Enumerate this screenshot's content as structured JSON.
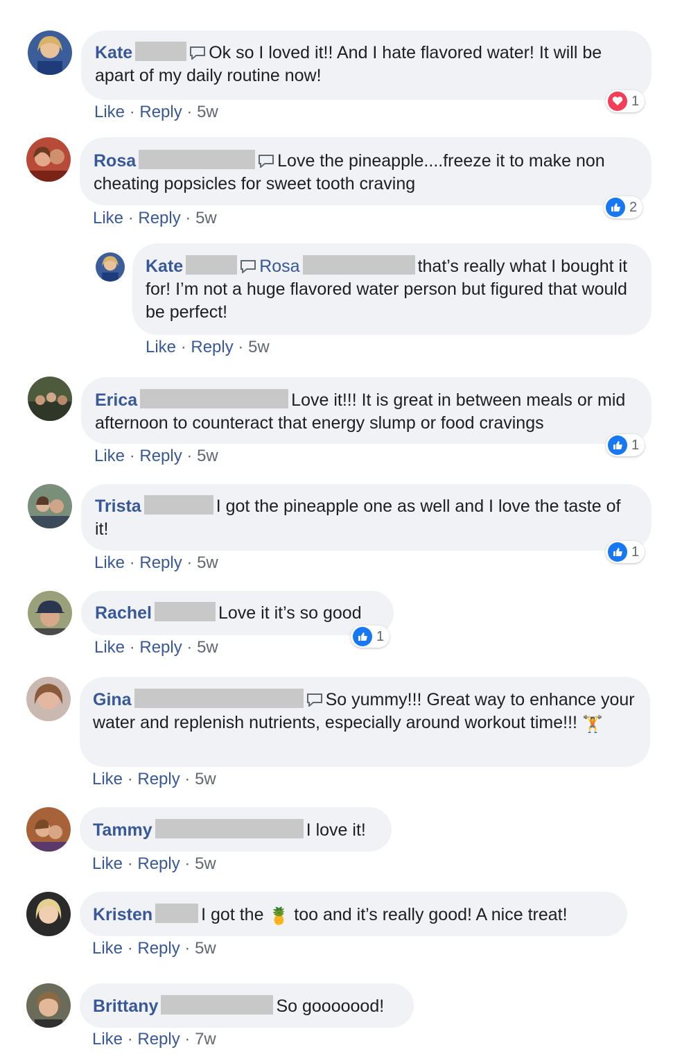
{
  "actions": {
    "like": "Like",
    "reply": "Reply",
    "sep": "·"
  },
  "comments": [
    {
      "name": "Kate",
      "text": "Ok so I loved it!! And I hate flavored water! It will be apart of my daily routine now!",
      "time": "5w",
      "reaction": {
        "type": "love",
        "count": "1"
      }
    },
    {
      "name": "Rosa",
      "text": "Love the pineapple....freeze it to make non cheating popsicles for sweet tooth craving",
      "time": "5w",
      "reaction": {
        "type": "like",
        "count": "2"
      }
    },
    {
      "name": "Kate",
      "mention": "Rosa",
      "text": "that’s really what I bought it for! I’m not a huge flavored water person but figured that would be perfect!",
      "time": "5w"
    },
    {
      "name": "Erica",
      "text": "Love it!!! It is great in between meals or mid afternoon to counteract that energy slump or food cravings",
      "time": "5w",
      "reaction": {
        "type": "like",
        "count": "1"
      }
    },
    {
      "name": "Trista",
      "text": "I got the pineapple one as well and I love the taste of it!",
      "time": "5w",
      "reaction": {
        "type": "like",
        "count": "1"
      }
    },
    {
      "name": "Rachel",
      "text": "Love it it’s so good",
      "time": "5w",
      "reaction": {
        "type": "like",
        "count": "1"
      }
    },
    {
      "name": "Gina",
      "text": "So yummy!!! Great way to enhance your water and replenish nutrients, especially around workout time!!!",
      "emoji": "🏋",
      "time": "5w"
    },
    {
      "name": "Tammy",
      "text": "I love it!",
      "time": "5w"
    },
    {
      "name": "Kristen",
      "text_before": "I got the",
      "emoji": "🍍",
      "text_after": "too and it’s really good! A nice treat!",
      "time": "5w"
    },
    {
      "name": "Brittany",
      "text": "So gooooood!",
      "time": "7w"
    }
  ],
  "colors": {
    "link": "#385898",
    "bubble": "#f0f2f5",
    "like": "#1877f2",
    "love": "#f33e58",
    "redaction": "#c8c8c8"
  },
  "icons": {
    "translate": "message-bubble-icon",
    "like": "thumbs-up-icon",
    "love": "heart-icon"
  }
}
